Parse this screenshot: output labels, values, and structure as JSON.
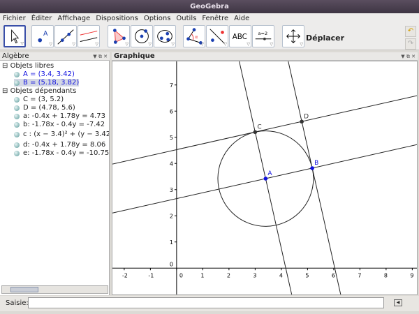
{
  "window": {
    "title": "GeoGebra"
  },
  "menu": [
    "Fichier",
    "Éditer",
    "Affichage",
    "Dispositions",
    "Options",
    "Outils",
    "Fenêtre",
    "Aide"
  ],
  "toolbar": {
    "mode": "Déplacer",
    "text_tool": "ABC",
    "slider_tool": "a=2"
  },
  "algebra": {
    "title": "Algèbre",
    "groups": [
      {
        "label": "Objets libres",
        "items": [
          "A = (3.4, 3.42)",
          "B = (5.18, 3.82)"
        ]
      },
      {
        "label": "Objets dépendants",
        "items": [
          "C = (3, 5.2)",
          "D = (4.78, 5.6)",
          "a: -0.4x + 1.78y = 4.73",
          "b: -1.78x - 0.4y = -7.42",
          "c : (x − 3.4)² + (y − 3.42",
          "d: -0.4x + 1.78y = 8.06",
          "e: -1.78x - 0.4y = -10.75"
        ]
      }
    ]
  },
  "graphics": {
    "title": "Graphique",
    "xlim": [
      -2.45,
      9.23
    ],
    "ylim": [
      -1.06,
      7.9
    ],
    "xticks": [
      "-2",
      "-1",
      "0",
      "1",
      "2",
      "3",
      "4",
      "5",
      "6",
      "7",
      "8",
      "9"
    ],
    "yticks": [
      "0",
      "1",
      "2",
      "3",
      "4",
      "5",
      "6",
      "7"
    ],
    "points": [
      {
        "name": "A",
        "x": 3.4,
        "y": 3.42,
        "color": "#1010e0"
      },
      {
        "name": "B",
        "x": 5.18,
        "y": 3.82,
        "color": "#1010e0"
      },
      {
        "name": "C",
        "x": 3,
        "y": 5.2,
        "color": "#333333"
      },
      {
        "name": "D",
        "x": 4.78,
        "y": 5.6,
        "color": "#333333"
      }
    ],
    "lines": [
      {
        "name": "a",
        "a": -0.4,
        "b": 1.78,
        "c": 4.73
      },
      {
        "name": "b",
        "a": -1.78,
        "b": -0.4,
        "c": -7.42
      },
      {
        "name": "d",
        "a": -0.4,
        "b": 1.78,
        "c": 8.06
      },
      {
        "name": "e",
        "a": -1.78,
        "b": -0.4,
        "c": -10.75
      }
    ],
    "circle": {
      "name": "c",
      "cx": 3.4,
      "cy": 3.42,
      "r": 1.824
    }
  },
  "input": {
    "label": "Saisie:",
    "value": ""
  }
}
